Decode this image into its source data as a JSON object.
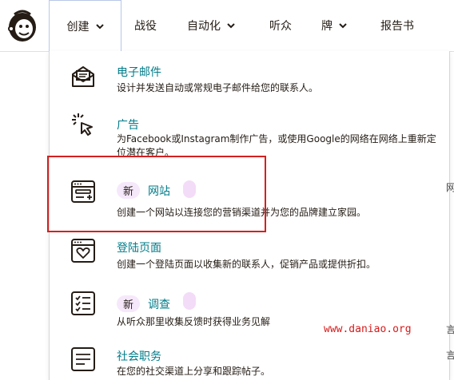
{
  "nav": {
    "create": "创建",
    "campaigns": "战役",
    "automation": "自动化",
    "audience": "听众",
    "brand": "牌",
    "reports": "报告书"
  },
  "menu": [
    {
      "title": "电子邮件",
      "desc": "设计并发送自动或常规电子邮件给您的联系人。",
      "icon": "email-icon"
    },
    {
      "title": "广告",
      "desc": "为Facebook或Instagram制作广告，或使用Google的网络在网络上重新定位潜在客户。",
      "icon": "click-cursor-icon"
    },
    {
      "title": "网站",
      "badge": "新",
      "desc": "创建一个网站以连接您的营销渠道并为您的品牌建立家园。",
      "icon": "website-icon"
    },
    {
      "title": "登陆页面",
      "desc": "创建一个登陆页面以收集新的联系人，促销产品或提供折扣。",
      "icon": "landing-page-heart-icon"
    },
    {
      "title": "调查",
      "badge": "新",
      "desc": "从听众那里收集反馈时获得业务见解",
      "icon": "survey-checklist-icon"
    },
    {
      "title": "社会职务",
      "desc": "在您的社交渠道上分享和跟踪帖子。",
      "icon": "social-post-icon"
    }
  ],
  "watermark": "www.daniao.org",
  "right_edge": [
    "网",
    "言",
    "言"
  ]
}
